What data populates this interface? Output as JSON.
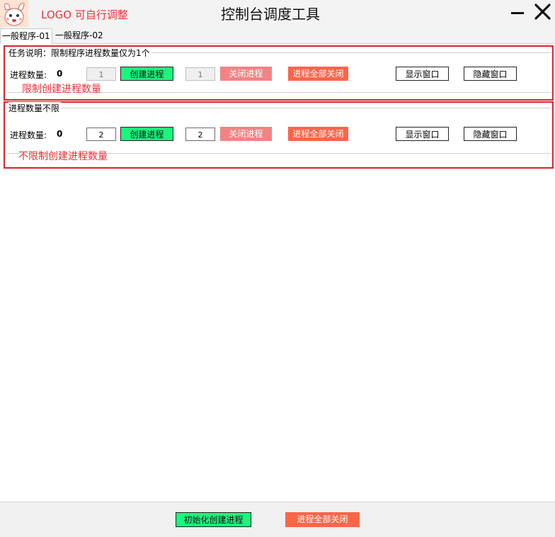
{
  "window": {
    "logo_text": "LOGO 可自行调整",
    "title": "控制台调度工具"
  },
  "tabs": [
    {
      "label": "一般程序-01",
      "active": true
    },
    {
      "label": "一般程序-02",
      "active": false
    }
  ],
  "group1": {
    "legend": "任务说明：限制程序进程数量仅为1个",
    "count_label": "进程数量:",
    "count_value": "0",
    "create_qty": "1",
    "create_label": "创建进程",
    "close_qty": "1",
    "close_label": "关闭进程",
    "close_all_label": "进程全部关闭",
    "show_label": "显示窗口",
    "hide_label": "隐藏窗口",
    "note": "限制创建进程数量"
  },
  "group2": {
    "legend": "进程数量不限",
    "count_label": "进程数量:",
    "count_value": "0",
    "create_qty": "2",
    "create_label": "创建进程",
    "close_qty": "2",
    "close_label": "关闭进程",
    "close_all_label": "进程全部关闭",
    "show_label": "显示窗口",
    "hide_label": "隐藏窗口",
    "note": "不限制创建进程数量"
  },
  "footer": {
    "init_label": "初始化创建进程",
    "close_all_label": "进程全部关闭"
  },
  "colors": {
    "accent_red": "#e8323a",
    "create_green": "#19f57d",
    "close_pink": "#f08484",
    "close_all_orange": "#fb6549"
  },
  "icons": {
    "logo": "cartoon-mascot-icon",
    "minimize": "minimize-icon",
    "close": "close-icon"
  }
}
